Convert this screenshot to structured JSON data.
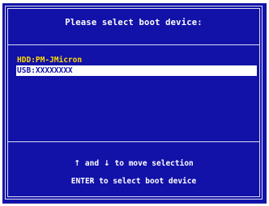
{
  "header": {
    "title": "Please select boot device:"
  },
  "devices": [
    {
      "label": "HDD:PM-JMicron",
      "selected": false
    },
    {
      "label": "USB:XXXXXXXX",
      "selected": true
    }
  ],
  "help": {
    "up_arrow": "↑",
    "and_text": "and",
    "down_arrow": "↓",
    "move_text": "to move selection",
    "enter_text": "ENTER to select boot device"
  },
  "colors": {
    "background": "#1212a8",
    "border": "#dcdcf0",
    "title_text": "#ffffff",
    "device_text": "#ffd800",
    "selected_background": "#ffffff",
    "selected_text": "#1212a8"
  }
}
